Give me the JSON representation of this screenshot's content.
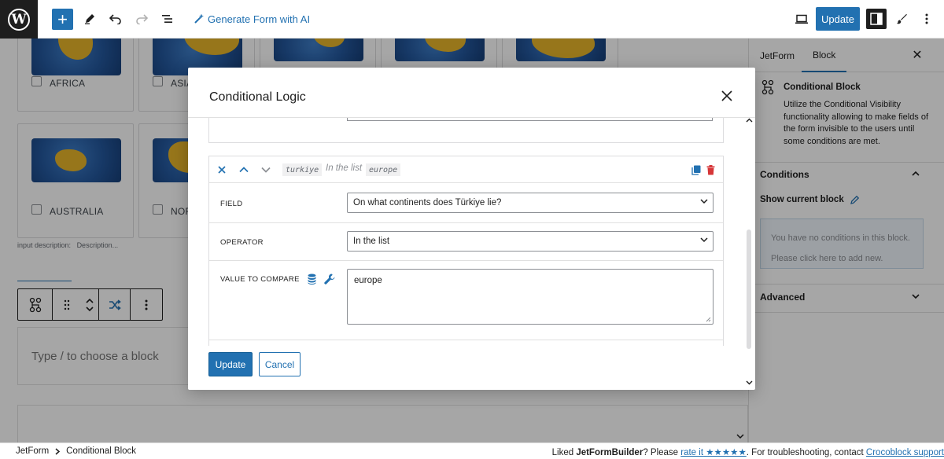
{
  "topbar": {
    "generate_label": "Generate Form with AI",
    "update_label": "Update"
  },
  "canvas": {
    "cards": [
      {
        "label": "AFRICA"
      },
      {
        "label": "ASIA"
      },
      {
        "label": "AUSTRALIA"
      },
      {
        "label": "NOR"
      }
    ],
    "input_description": "input description:",
    "description_placeholder": "Description...",
    "block_placeholder": "Type / to choose a block"
  },
  "sidebar": {
    "tabs": [
      "JetForm",
      "Block"
    ],
    "block_title": "Conditional Block",
    "block_description": "Utilize the Conditional Visibility functionality allowing to make fields of the form invisible to the users until some conditions are met.",
    "conditions_title": "Conditions",
    "show_current_block": "Show current block",
    "notice_line1": "You have no conditions in this block.",
    "notice_line2": "Please click here to add new.",
    "advanced_title": "Advanced"
  },
  "modal": {
    "title": "Conditional Logic",
    "condition": {
      "field_chip": "turkiye",
      "operator_text": "In the list",
      "value_chip": "europe",
      "field_label": "FIELD",
      "field_value": "On what continents does Türkiye lie?",
      "operator_label": "OPERATOR",
      "operator_value": "In the list",
      "value_label": "VALUE TO COMPARE",
      "value_value": "europe"
    },
    "update_label": "Update",
    "cancel_label": "Cancel"
  },
  "footer": {
    "crumb_1": "JetForm",
    "crumb_2": "Conditional Block",
    "liked_text": "Liked ",
    "brand": "JetFormBuilder",
    "please_text": "? Please ",
    "rate_link": "rate it",
    "stars": " ★★★★★",
    "troubleshoot_text": ". For troubleshooting, contact ",
    "support_link": "Crocoblock support"
  },
  "colors": {
    "accent": "#2271b1",
    "danger": "#d63638",
    "notice_bg": "#f0f6fc",
    "globe_land": "#e8b52a",
    "globe_sea": "#24589e"
  }
}
